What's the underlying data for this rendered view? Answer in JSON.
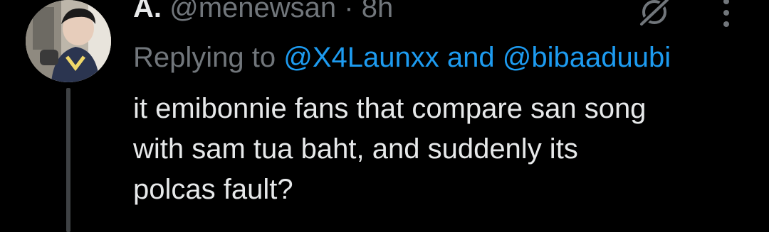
{
  "author": {
    "display_name": "A.",
    "handle": "@menewsan",
    "separator": "·",
    "timestamp": "8h"
  },
  "reply": {
    "prefix": "Replying to",
    "mentions": [
      "@X4Launxx",
      "@bibaaduubi"
    ],
    "conjunction": "and"
  },
  "tweet": {
    "text_lines": [
      "it emibonnie fans that compare san song",
      "with sam tua baht, and suddenly its",
      "polcas fault?"
    ]
  },
  "icons": {
    "grok": "grok-icon",
    "more": "more-options-icon",
    "avatar": "avatar"
  },
  "colors": {
    "background": "#000000",
    "text": "#e7e9ea",
    "secondary": "#71767b",
    "accent": "#1d9bf0",
    "thread_line": "#3e4144"
  }
}
